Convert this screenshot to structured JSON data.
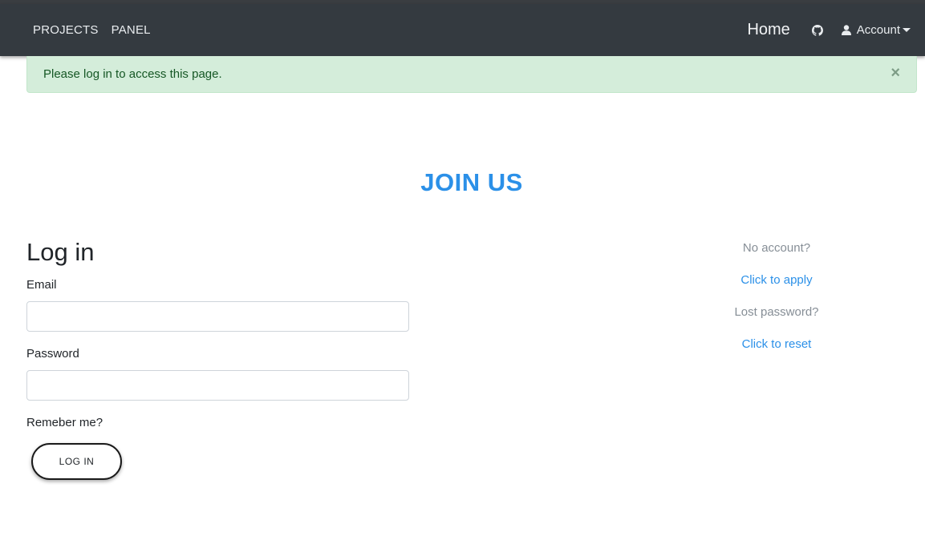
{
  "navbar": {
    "links": [
      "PROJECTS",
      "PANEL"
    ],
    "home_label": "Home",
    "github_icon": "github-icon",
    "account_label": "Account",
    "user_icon": "user-icon"
  },
  "alert": {
    "message": "Please log in to access this page.",
    "close_label": "×"
  },
  "headline": "JOIN US",
  "login_form": {
    "title": "Log in",
    "email_label": "Email",
    "email_value": "",
    "password_label": "Password",
    "password_value": "",
    "remember_label": "Remeber me?",
    "submit_label": "LOG IN"
  },
  "side_panel": {
    "no_account": "No account?",
    "apply_link": "Click to apply",
    "lost_password": "Lost password?",
    "reset_link": "Click to reset"
  },
  "colors": {
    "navbar": "#343a40",
    "alert_bg": "#d4edda",
    "alert_text": "#155724",
    "accent": "#2b90e8"
  }
}
